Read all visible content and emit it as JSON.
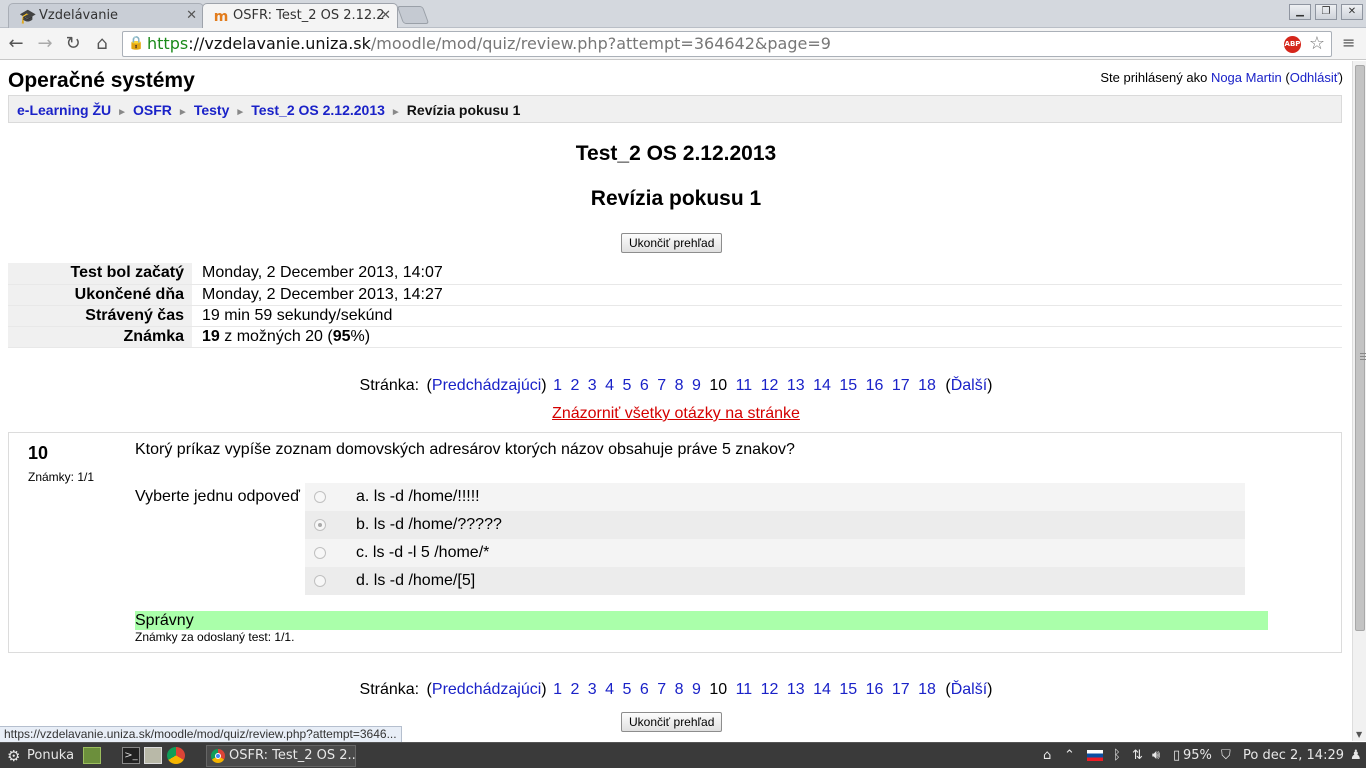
{
  "browser": {
    "tabs": [
      {
        "title": "Vzdelávanie",
        "active": false
      },
      {
        "title": "OSFR: Test_2 OS 2.12.2",
        "active": true
      }
    ],
    "url_scheme": "https",
    "url_host": "://vzdelavanie.uniza.sk",
    "url_path": "/moodle/mod/quiz/review.php?attempt=364642&page=9",
    "abp_label": "ABP",
    "status_url": "https://vzdelavanie.uniza.sk/moodle/mod/quiz/review.php?attempt=3646..."
  },
  "page": {
    "site_title": "Operačné systémy",
    "login": {
      "prefix": "Ste prihlásený ako ",
      "user": "Noga Martin",
      "open_paren": " (",
      "logout": "Odhlásiť",
      "close_paren": ")"
    },
    "breadcrumb": [
      "e-Learning ŽU",
      "OSFR",
      "Testy",
      "Test_2 OS 2.12.2013"
    ],
    "breadcrumb_current": "Revízia pokusu 1",
    "breadcrumb_sep": "►",
    "heading": "Test_2 OS 2.12.2013",
    "subheading": "Revízia pokusu 1",
    "finish_review_label": "Ukončiť prehľad",
    "summary": {
      "started_label": "Test bol začatý",
      "started_value": "Monday, 2 December 2013, 14:07",
      "completed_label": "Ukončené dňa",
      "completed_value": "Monday, 2 December 2013, 14:27",
      "time_label": "Strávený čas",
      "time_value": "19 min 59 sekundy/sekúnd",
      "grade_label": "Známka",
      "grade_score": "19",
      "grade_mid": " z možných 20 (",
      "grade_percent": "95",
      "grade_end": "%)"
    },
    "pager": {
      "label": "Stránka:",
      "prev": "Predchádzajúci",
      "next": "Ďalší",
      "pages": [
        "1",
        "2",
        "3",
        "4",
        "5",
        "6",
        "7",
        "8",
        "9",
        "10",
        "11",
        "12",
        "13",
        "14",
        "15",
        "16",
        "17",
        "18"
      ],
      "current": "10"
    },
    "show_all": "Znázorniť všetky otázky na stránke",
    "question": {
      "number": "10",
      "grade": "Známky: 1/1",
      "text": "Ktorý príkaz vypíše zoznam domovských adresárov ktorých názov obsahuje práve 5 znakov?",
      "prompt": "Vyberte jednu odpoveď",
      "answers": [
        {
          "label": "a. ls -d /home/!!!!!",
          "checked": false
        },
        {
          "label": "b. ls -d /home/?????",
          "checked": true
        },
        {
          "label": "c. ls -d -l 5 /home/*",
          "checked": false
        },
        {
          "label": "d. ls -d /home/[5]",
          "checked": false
        }
      ],
      "result": "Správny",
      "feedback": "Známky za odoslaný test: 1/1."
    }
  },
  "taskbar": {
    "menu_label": "Ponuka",
    "task_title": "OSFR: Test_2 OS 2....",
    "battery": "95%",
    "clock": "Po dec  2, 14:29"
  }
}
